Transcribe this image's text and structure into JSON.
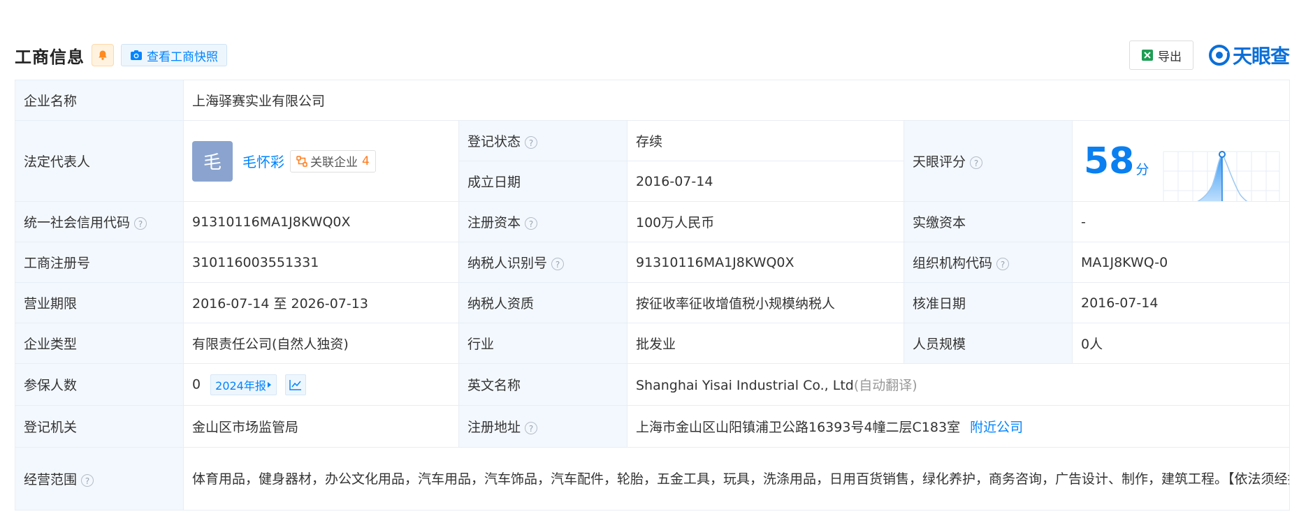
{
  "header": {
    "title": "工商信息",
    "snapshot_label": "查看工商快照",
    "export_label": "导出",
    "logo_text": "天眼查"
  },
  "colors": {
    "accent": "#0084ff",
    "status_green": "#13a462",
    "label_bg": "#f3f8fe",
    "border": "#e8eef5",
    "avatar_bg": "#8aa4cf",
    "related_count": "#ff7a1a"
  },
  "rows": {
    "company_name": {
      "label": "企业名称",
      "value": "上海驿赛实业有限公司"
    },
    "legal_rep": {
      "label": "法定代表人",
      "avatar_char": "毛",
      "name": "毛怀彩",
      "related_label": "关联企业",
      "related_count": "4"
    },
    "reg_status": {
      "label": "登记状态",
      "value": "存续"
    },
    "founded": {
      "label": "成立日期",
      "value": "2016-07-14"
    },
    "score": {
      "label": "天眼评分",
      "value": "58",
      "unit": "分",
      "ticks": [
        "0",
        "1",
        "3",
        "15",
        "50",
        "85",
        "97",
        "99",
        "100"
      ]
    },
    "credit_code": {
      "label": "统一社会信用代码",
      "value": "91310116MA1J8KWQ0X"
    },
    "reg_capital": {
      "label": "注册资本",
      "value": "100万人民币"
    },
    "paid_capital": {
      "label": "实缴资本",
      "value": "-"
    },
    "reg_number": {
      "label": "工商注册号",
      "value": "310116003551331"
    },
    "taxpayer_id": {
      "label": "纳税人识别号",
      "value": "91310116MA1J8KWQ0X"
    },
    "org_code": {
      "label": "组织机构代码",
      "value": "MA1J8KWQ-0"
    },
    "term": {
      "label": "营业期限",
      "value": "2016-07-14 至 2026-07-13"
    },
    "taxpayer_qual": {
      "label": "纳税人资质",
      "value": "按征收率征收增值税小规模纳税人"
    },
    "approval_date": {
      "label": "核准日期",
      "value": "2016-07-14"
    },
    "company_type": {
      "label": "企业类型",
      "value": "有限责任公司(自然人独资)"
    },
    "industry": {
      "label": "行业",
      "value": "批发业"
    },
    "staff_size": {
      "label": "人员规模",
      "value": "0人"
    },
    "insured": {
      "label": "参保人数",
      "value": "0",
      "report_tag": "2024年报"
    },
    "english_name": {
      "label": "英文名称",
      "value": "Shanghai Yisai Industrial Co., Ltd",
      "note": "(自动翻译)"
    },
    "reg_authority": {
      "label": "登记机关",
      "value": "金山区市场监管局"
    },
    "reg_address": {
      "label": "注册地址",
      "value": "上海市金山区山阳镇浦卫公路16393号4幢二层C183室",
      "nearby_link": "附近公司"
    },
    "scope": {
      "label": "经营范围",
      "value": "体育用品，健身器材，办公文化用品，汽车用品，汽车饰品，汽车配件，轮胎，五金工具，玩具，洗涤用品，日用百货销售，绿化养护，商务咨询，广告设计、制作，建筑工程。【依法须经批准的项目，经相关部门批准后方可开展经营活动】"
    }
  }
}
